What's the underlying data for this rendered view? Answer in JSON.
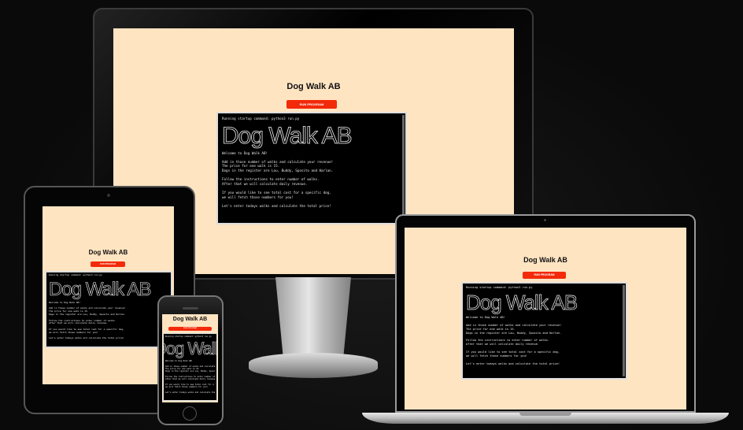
{
  "site": {
    "title": "Dog Walk AB",
    "run_button": "RUN PROGRAM"
  },
  "terminal": {
    "startup": "Running startup command: python3 run.py",
    "logo": "Dog Walk AB",
    "lines": [
      "Welcome to Dog Walk AB!",
      "",
      "Add in those number of walks and calculate your revenue!",
      "The price for one walk is 15.",
      "Dogs in the register are Lou, Buddy, Sposito and Harlan.",
      "",
      "Follow the instructions to enter number of walks.",
      "After that we will calculate daily revenue.",
      "",
      "If you would like to see total cost for a specific dog,",
      "we will fetch those numbers for you!",
      "",
      "Let's enter todays walks and calculate the total price!"
    ]
  },
  "colors": {
    "page_background": "#ffe4c2",
    "button": "#f22a0a",
    "terminal_background": "#000000"
  }
}
